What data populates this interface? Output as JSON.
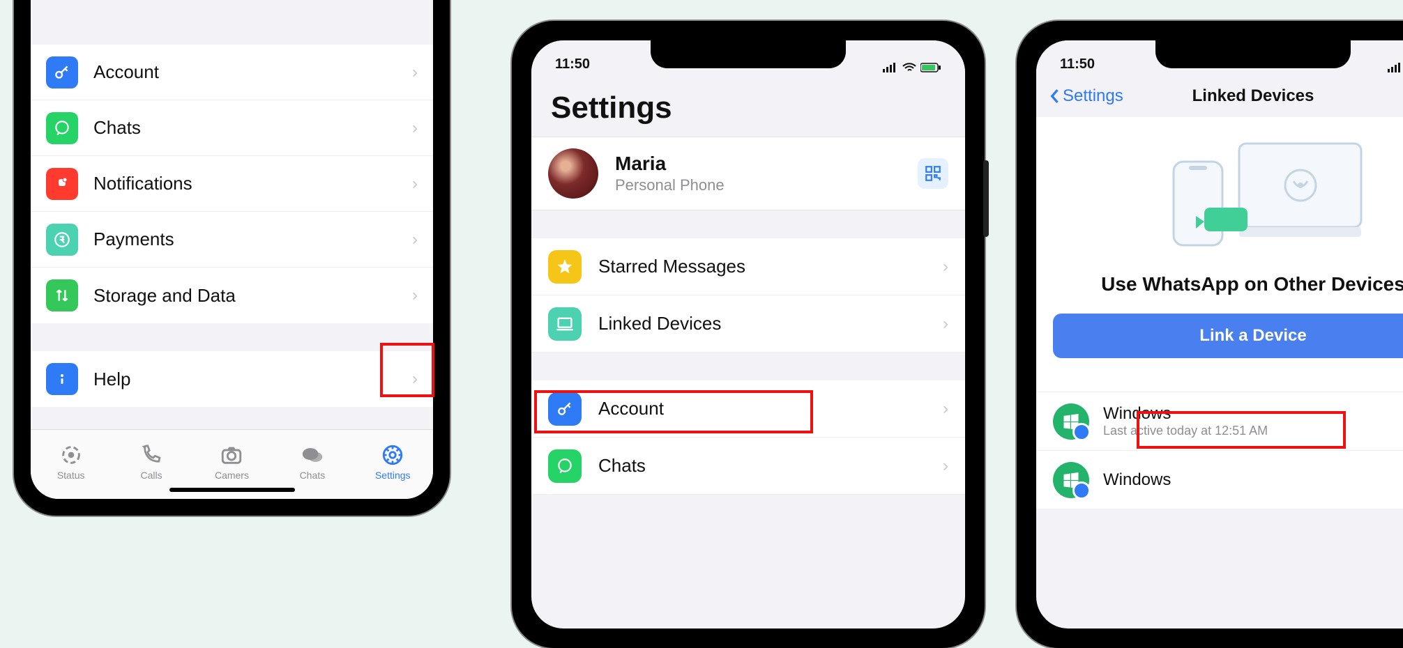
{
  "phone1": {
    "rows": [
      {
        "label": "Account",
        "color": "#2f7af5",
        "icon": "key"
      },
      {
        "label": "Chats",
        "color": "#25d366",
        "icon": "whatsapp"
      },
      {
        "label": "Notifications",
        "color": "#ff3b30",
        "icon": "bell"
      },
      {
        "label": "Payments",
        "color": "#4cd1b1",
        "icon": "rupee"
      },
      {
        "label": "Storage and Data",
        "color": "#34c759",
        "icon": "arrows"
      }
    ],
    "help_label": "Help",
    "tabs": [
      {
        "label": "Status"
      },
      {
        "label": "Calls"
      },
      {
        "label": "Camers"
      },
      {
        "label": "Chats"
      },
      {
        "label": "Settings"
      }
    ]
  },
  "phone2": {
    "time": "11:50",
    "title": "Settings",
    "profile_name": "Maria",
    "profile_sub": "Personal Phone",
    "rows": [
      {
        "label": "Starred Messages",
        "color": "#f5c518",
        "icon": "star"
      },
      {
        "label": "Linked Devices",
        "color": "#4cd1b1",
        "icon": "laptop"
      }
    ],
    "rows2": [
      {
        "label": "Account",
        "color": "#2f7af5",
        "icon": "key"
      },
      {
        "label": "Chats",
        "color": "#25d366",
        "icon": "whatsapp"
      }
    ]
  },
  "phone3": {
    "time": "11:50",
    "back_label": "Settings",
    "nav_title": "Linked Devices",
    "headline": "Use WhatsApp on Other Devices",
    "cta": "Link a Device",
    "devices": [
      {
        "name": "Windows",
        "sub": "Last active today at 12:51 AM"
      },
      {
        "name": "Windows",
        "sub": ""
      }
    ]
  }
}
